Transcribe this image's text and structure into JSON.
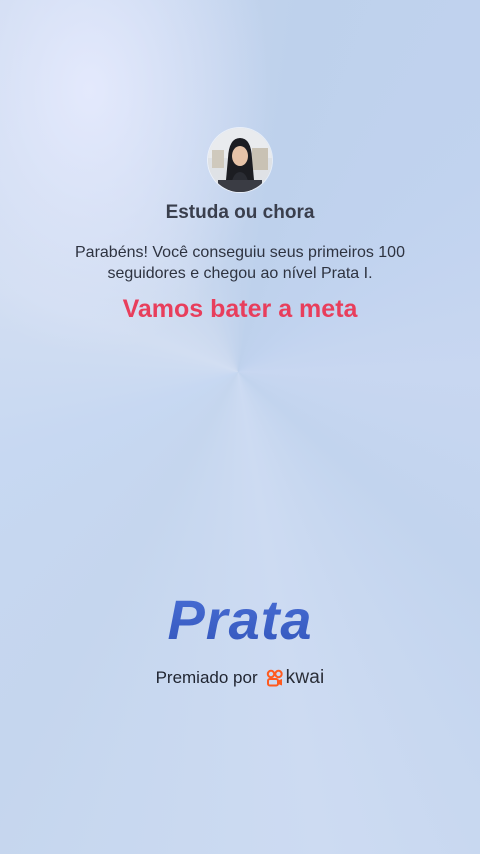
{
  "profile": {
    "username": "Estuda ou chora",
    "avatar_icon": "profile-photo"
  },
  "message": {
    "text": "Parabéns! Você conseguiu seus primeiros 100 seguidores e chegou ao nível Prata I."
  },
  "goal": {
    "text": "Vamos bater a meta"
  },
  "level": {
    "name": "Prata"
  },
  "award": {
    "label": "Premiado por",
    "brand": "kwai",
    "brand_icon": "kwai-logo-icon"
  },
  "colors": {
    "goal": "#e83e5c",
    "level": "#3e63c9",
    "brand": "#ff5a1f"
  }
}
